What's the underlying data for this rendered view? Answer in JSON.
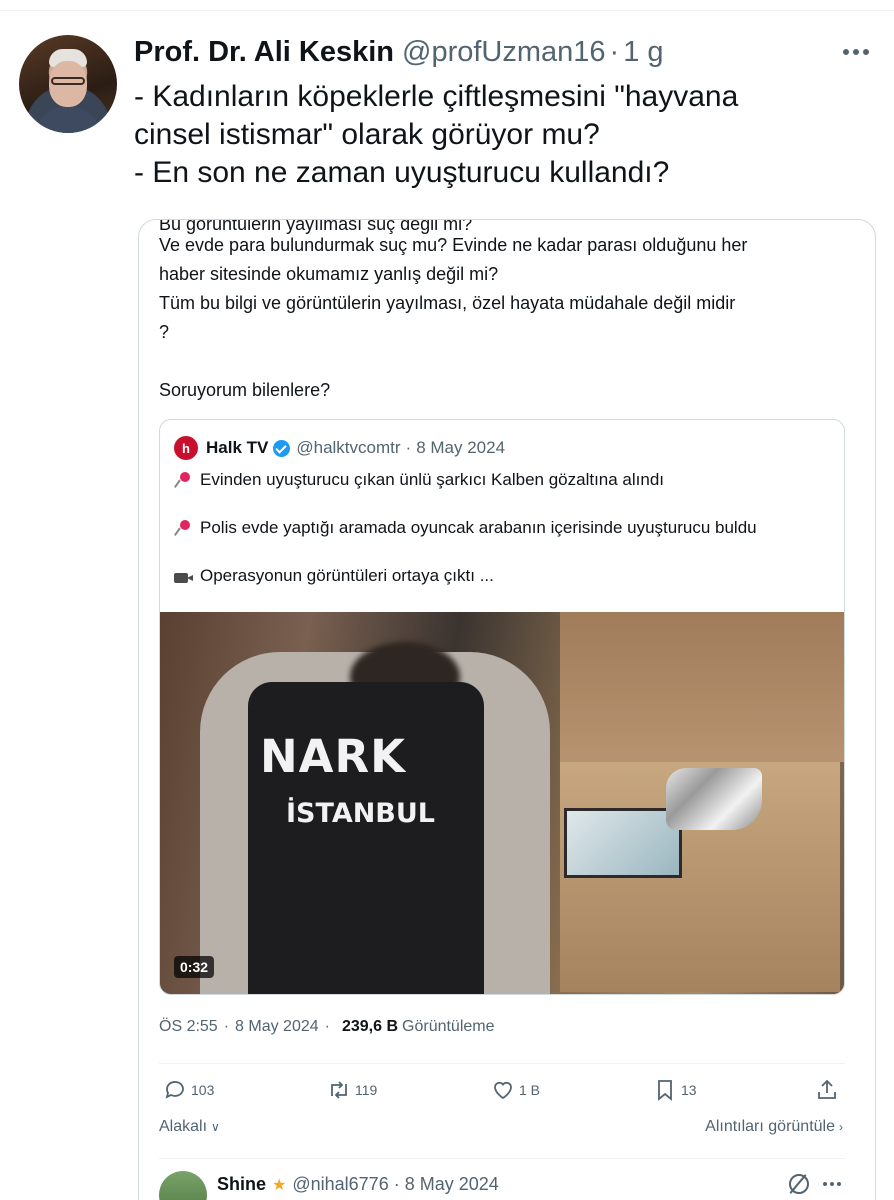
{
  "tweet": {
    "author_name": "Prof. Dr. Ali Keskin",
    "author_handle": "@profUzman16",
    "dot": "·",
    "time_ago": "1 g",
    "text_lines": [
      "- Kadınların köpeklerle çiftleşmesini \"hayvana",
      "cinsel istismar\" olarak görüyor mu?",
      "- En son ne zaman uyuşturucu kullandı?"
    ]
  },
  "quoted": {
    "cut_line": "Bu görüntülerin yayılması suç değil mi?",
    "text_lines": [
      "Ve evde para bulundurmak suç mu? Evinde ne kadar parası olduğunu her",
      "haber sitesinde okumamız yanlış değil mi?",
      "Tüm bu bilgi ve görüntülerin yayılması, özel hayata müdahale değil midir",
      "?",
      "",
      "Soruyorum bilenlere?"
    ],
    "inner": {
      "logo_letter": "h",
      "name": "Halk TV",
      "handle": "@halktvcomtr",
      "dot": "·",
      "date": "8 May 2024",
      "line1": "Evinden uyuşturucu çıkan ünlü şarkıcı Kalben gözaltına alındı",
      "line2": "Polis evde yaptığı aramada oyuncak arabanın içerisinde uyuşturucu buldu",
      "line3": "Operasyonun görüntüleri ortaya çıktı ...",
      "video_vest_top": "NARK",
      "video_vest_bottom": "İSTANBUL",
      "video_duration": "0:32"
    },
    "meta": {
      "time": "ÖS 2:55",
      "sep": "·",
      "date": "8 May 2024",
      "views_count": "239,6 B",
      "views_label": "Görüntüleme"
    },
    "actions": {
      "replies": "103",
      "retweets": "119",
      "likes": "1 B",
      "bookmarks": "13"
    },
    "footer": {
      "related": "Alakalı",
      "view_quotes": "Alıntıları görüntüle"
    },
    "reply": {
      "name": "Shine",
      "handle": "@nihal6776",
      "dot": "·",
      "date": "8 May 2024"
    }
  },
  "icons": {
    "more": "more-icon",
    "verified": "verified-icon",
    "pin": "pin-icon",
    "camera": "camera-icon",
    "reply": "reply-icon",
    "retweet": "retweet-icon",
    "like": "heart-icon",
    "bookmark": "bookmark-icon",
    "share": "share-icon",
    "star": "star-icon",
    "grok": "grok-icon"
  },
  "colors": {
    "text": "#0f1419",
    "secondary": "#536471",
    "border": "#cfd9de",
    "verified": "#1d9bf0",
    "brand_halktv": "#c8102e"
  }
}
